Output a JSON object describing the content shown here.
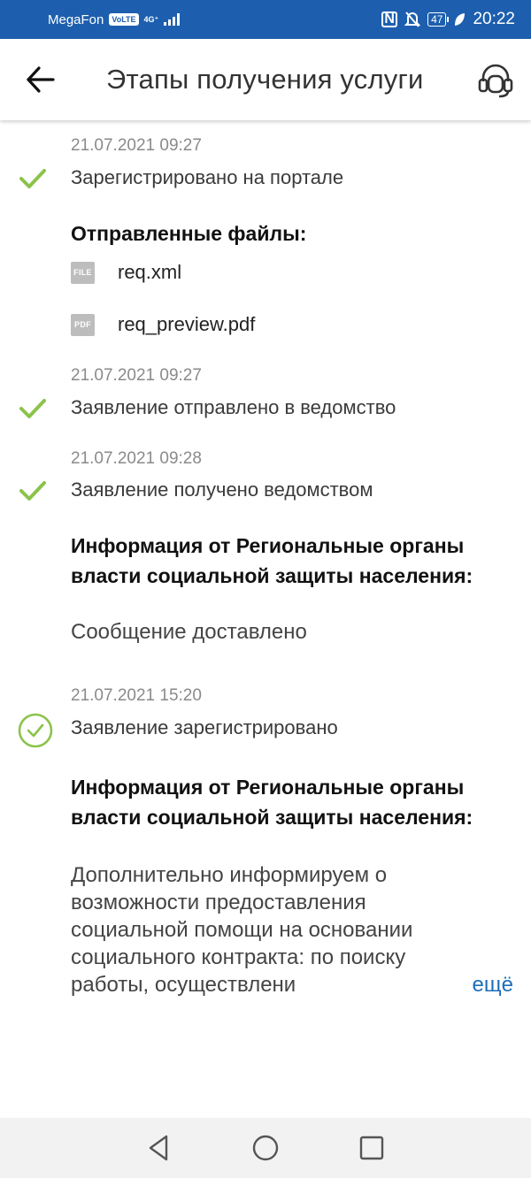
{
  "status_bar": {
    "carrier": "MegaFon",
    "volte": "VoLTE",
    "network": "4G⁺",
    "battery": "47",
    "time": "20:22"
  },
  "header": {
    "title": "Этапы получения услуги"
  },
  "stages": [
    {
      "date": "21.07.2021 09:27",
      "status": "Зарегистрировано на портале"
    },
    {
      "date": "21.07.2021 09:27",
      "status": "Заявление отправлено в ведомство"
    },
    {
      "date": "21.07.2021 09:28",
      "status": "Заявление получено ведомством"
    },
    {
      "date": "21.07.2021 15:20",
      "status": "Заявление зарегистрировано"
    }
  ],
  "files": {
    "title": "Отправленные файлы:",
    "items": [
      {
        "type": "FILE",
        "name": "req.xml"
      },
      {
        "type": "PDF",
        "name": "req_preview.pdf"
      }
    ]
  },
  "info_blocks": [
    {
      "title": "Информация от Региональные органы власти социальной защиты населения:",
      "message": "Сообщение доставлено"
    },
    {
      "title": "Информация от Региональные органы власти социальной защиты населения:",
      "message": "Дополнительно информируем о возможности предоставления социальной помощи на основании социального контракта: по поиску работы, осуществлени",
      "more_label": "ещё"
    }
  ],
  "colors": {
    "status_bar": "#1d5fae",
    "check_green": "#8bc34a",
    "link_blue": "#1d6fb8"
  }
}
